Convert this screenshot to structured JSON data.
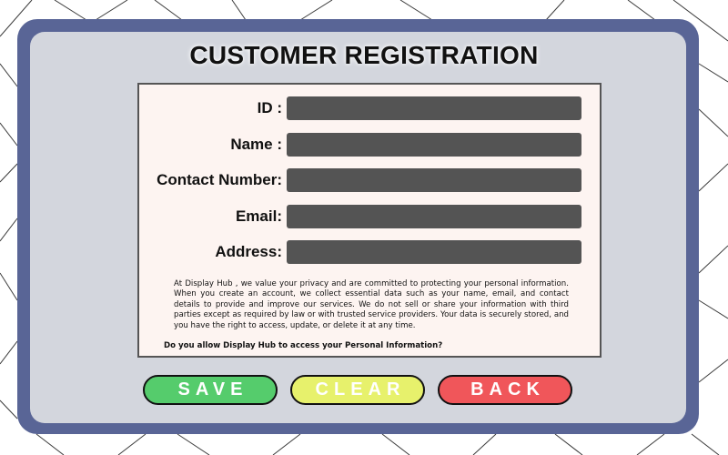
{
  "title": "CUSTOMER REGISTRATION",
  "form": {
    "fields": [
      {
        "label": "ID :",
        "value": ""
      },
      {
        "label": "Name :",
        "value": ""
      },
      {
        "label": "Contact Number:",
        "value": ""
      },
      {
        "label": "Email:",
        "value": ""
      },
      {
        "label": "Address:",
        "value": ""
      }
    ],
    "privacy_text": "At Display Hub , we value your privacy and are committed to protecting your personal information. When you create an account, we collect essential data such as your name, email, and contact details to provide and improve our services. We do not sell or share your information with third parties except as required by law or with trusted service providers. Your data is securely stored, and you have the right to access, update, or delete it at any time.",
    "consent_question": "Do you allow Display Hub to access your Personal Information?"
  },
  "buttons": {
    "save": "SAVE",
    "clear": "CLEAR",
    "back": "BACK"
  },
  "colors": {
    "frame": "#596596",
    "panel": "#d3d6dd",
    "form_background": "#fdf4f1",
    "input_fill": "#545454",
    "save": "#55cc6c",
    "clear": "#e7f16c",
    "back": "#f0565a"
  }
}
